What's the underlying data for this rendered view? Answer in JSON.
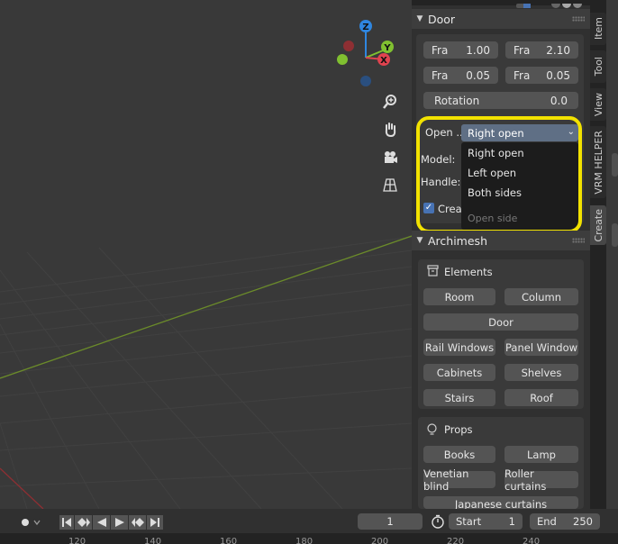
{
  "sidebar_tabs": [
    "Item",
    "Tool",
    "View",
    "VRM HELPER",
    "Create"
  ],
  "door_panel": {
    "title": "Door",
    "fields": [
      {
        "label": "Fra",
        "value": "1.00"
      },
      {
        "label": "Fra",
        "value": "2.10"
      },
      {
        "label": "Fra",
        "value": "0.05"
      },
      {
        "label": "Fra",
        "value": "0.05"
      }
    ],
    "rotation": {
      "label": "Rotation",
      "value": "0.0"
    },
    "open_label": "Open ...",
    "open_selected": "Right open",
    "open_options": [
      "Right open",
      "Left open",
      "Both sides"
    ],
    "open_menu_title": "Open side",
    "model_label": "Model:",
    "handle_label": "Handle:",
    "create_label": "Creat"
  },
  "archimesh": {
    "title": "Archimesh",
    "elements_title": "Elements",
    "elements": {
      "room": "Room",
      "column": "Column",
      "door": "Door",
      "rail_windows": "Rail Windows",
      "panel_window": "Panel Window",
      "cabinets": "Cabinets",
      "shelves": "Shelves",
      "stairs": "Stairs",
      "roof": "Roof"
    },
    "props_title": "Props",
    "props": {
      "books": "Books",
      "lamp": "Lamp",
      "venetian_blind": "Venetian blind",
      "roller_curtains": "Roller curtains",
      "japanese_curtains": "Japanese curtains"
    }
  },
  "timeline": {
    "current_frame": "1",
    "start_label": "Start",
    "start_value": "1",
    "end_label": "End",
    "end_value": "250",
    "ruler": [
      "120",
      "140",
      "160",
      "180",
      "200",
      "220",
      "240"
    ]
  },
  "gizmo_axes": [
    "Z",
    "Y",
    "X"
  ],
  "colors": {
    "highlight": "#f2e200",
    "selected": "#5f6f85",
    "axis_x": "#e0434f",
    "axis_y": "#80c030",
    "axis_z": "#2f86e0",
    "checkbox": "#4772b3"
  }
}
